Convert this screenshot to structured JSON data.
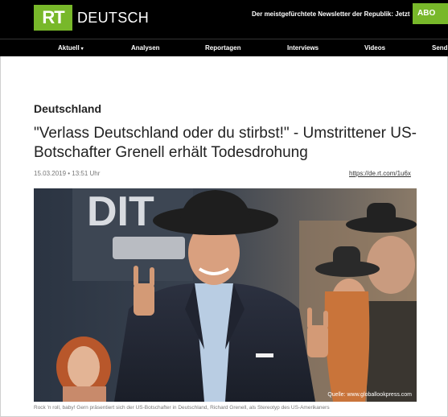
{
  "header": {
    "logo_text": "RT",
    "brand_text": "DEUTSCH",
    "promo_text": "Der meistgefürchtete Newsletter der Republik: Jetzt",
    "abo_label": "ABO"
  },
  "nav": {
    "items": [
      "Aktuell",
      "Analysen",
      "Reportagen",
      "Interviews",
      "Videos",
      "Send"
    ],
    "caret": "▾"
  },
  "article": {
    "section": "Deutschland",
    "title": "\"Verlass Deutschland oder du stirbst!\" - Umstrittener US-Botschafter Grenell erhält Todesdrohung",
    "date": "15.03.2019 • 13:51 Uhr",
    "short_link": "https://de.rt.com/1u6x",
    "photo_credit": "Quelle: www.globallookpress.com",
    "caption": "Rock 'n roll, baby! Gern präsentiert sich der US-Botschafter in Deutschland, Richard Grenell, als Stereotyp des US-Amerikaners",
    "backdrop_text": "DIT"
  },
  "colors": {
    "brand_green": "#78b82a",
    "header_bg": "#000000"
  }
}
